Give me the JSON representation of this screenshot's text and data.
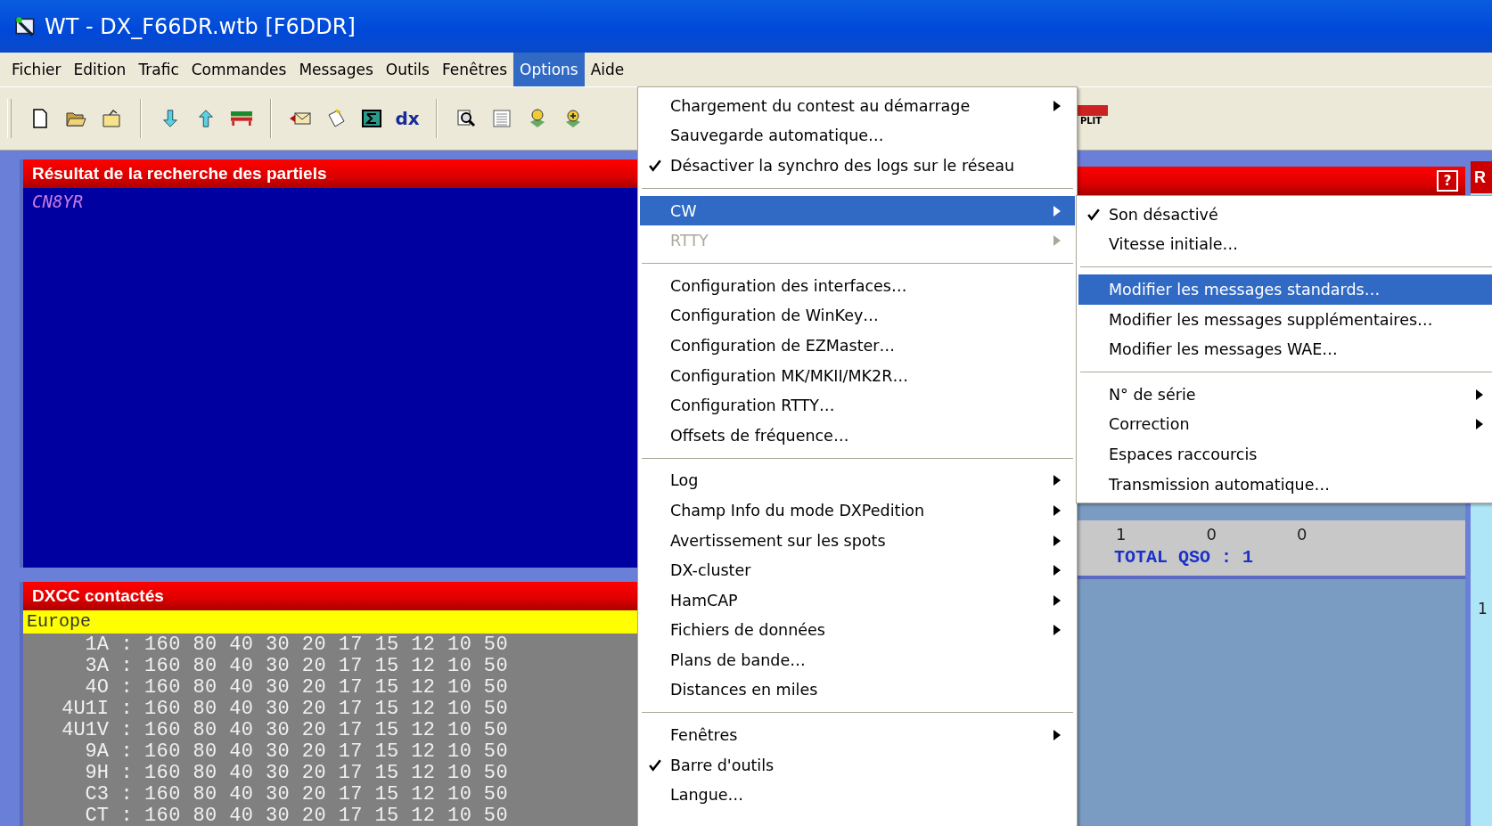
{
  "window": {
    "title": "WT - DX_F66DR.wtb [F6DDR]"
  },
  "menu_bar": [
    {
      "label": "Fichier",
      "selected": false
    },
    {
      "label": "Edition",
      "selected": false
    },
    {
      "label": "Trafic",
      "selected": false
    },
    {
      "label": "Commandes",
      "selected": false
    },
    {
      "label": "Messages",
      "selected": false
    },
    {
      "label": "Outils",
      "selected": false
    },
    {
      "label": "Fenêtres",
      "selected": false
    },
    {
      "label": "Options",
      "selected": true
    },
    {
      "label": "Aide",
      "selected": false
    }
  ],
  "toolbar": [
    {
      "kind": "new-file"
    },
    {
      "kind": "open-folder"
    },
    {
      "kind": "folder"
    },
    {
      "kind": "separator"
    },
    {
      "kind": "arrow-down"
    },
    {
      "kind": "arrow-up"
    },
    {
      "kind": "bars"
    },
    {
      "kind": "separator"
    },
    {
      "kind": "envelope"
    },
    {
      "kind": "note"
    },
    {
      "kind": "sigma"
    },
    {
      "kind": "text",
      "label": "dx"
    },
    {
      "kind": "separator"
    },
    {
      "kind": "magnifier"
    },
    {
      "kind": "grid"
    },
    {
      "kind": "pin"
    },
    {
      "kind": "pin2"
    }
  ],
  "split_button": {
    "label": "PLIT"
  },
  "search_panel": {
    "title": "Résultat de la recherche des partiels",
    "entries": [
      "CN8YR"
    ]
  },
  "dxcc_panel": {
    "title": "DXCC contactés",
    "region": "Europe",
    "rows": [
      {
        "prefix": "1A",
        "sep": ":",
        "bands": "160 80 40 30 20 17 15 12 10 50"
      },
      {
        "prefix": "3A",
        "sep": ":",
        "bands": "160 80 40 30 20 17 15 12 10 50"
      },
      {
        "prefix": "4O",
        "sep": ":",
        "bands": "160 80 40 30 20 17 15 12 10 50"
      },
      {
        "prefix": "4U1I",
        "sep": ":",
        "bands": "160 80 40 30 20 17 15 12 10 50"
      },
      {
        "prefix": "4U1V",
        "sep": ":",
        "bands": "160 80 40 30 20 17 15 12 10 50"
      },
      {
        "prefix": "9A",
        "sep": ":",
        "bands": "160 80 40 30 20 17 15 12 10 50"
      },
      {
        "prefix": "9H",
        "sep": ":",
        "bands": "160 80 40 30 20 17 15 12 10 50"
      },
      {
        "prefix": "C3",
        "sep": ":",
        "bands": "160 80 40 30 20 17 15 12 10 50"
      },
      {
        "prefix": "CT",
        "sep": ":",
        "bands": "160 80 40 30 20 17 15 12 10 50"
      }
    ]
  },
  "stats_panel": {
    "help_label": "?",
    "counts": [
      "1",
      "0",
      "0"
    ],
    "total": "TOTAL QSO : 1"
  },
  "side_panel": {
    "header": "R",
    "value": "1"
  },
  "options_menu": [
    {
      "kind": "item",
      "label": "Chargement du contest au démarrage",
      "checked": false,
      "disabled": false,
      "submenu": true,
      "selected": false
    },
    {
      "kind": "item",
      "label": "Sauvegarde automatique…",
      "checked": false,
      "disabled": false,
      "submenu": false,
      "selected": false
    },
    {
      "kind": "item",
      "label": "Désactiver la synchro des logs sur le réseau",
      "checked": true,
      "disabled": false,
      "submenu": false,
      "selected": false
    },
    {
      "kind": "separator"
    },
    {
      "kind": "item",
      "label": "CW",
      "checked": false,
      "disabled": false,
      "submenu": true,
      "selected": true
    },
    {
      "kind": "item",
      "label": "RTTY",
      "checked": false,
      "disabled": true,
      "submenu": true,
      "selected": false
    },
    {
      "kind": "separator"
    },
    {
      "kind": "item",
      "label": "Configuration des interfaces…",
      "checked": false,
      "disabled": false,
      "submenu": false,
      "selected": false
    },
    {
      "kind": "item",
      "label": "Configuration de WinKey…",
      "checked": false,
      "disabled": false,
      "submenu": false,
      "selected": false
    },
    {
      "kind": "item",
      "label": "Configuration de EZMaster…",
      "checked": false,
      "disabled": false,
      "submenu": false,
      "selected": false
    },
    {
      "kind": "item",
      "label": "Configuration MK/MKII/MK2R…",
      "checked": false,
      "disabled": false,
      "submenu": false,
      "selected": false
    },
    {
      "kind": "item",
      "label": "Configuration RTTY…",
      "checked": false,
      "disabled": false,
      "submenu": false,
      "selected": false
    },
    {
      "kind": "item",
      "label": "Offsets de fréquence…",
      "checked": false,
      "disabled": false,
      "submenu": false,
      "selected": false
    },
    {
      "kind": "separator"
    },
    {
      "kind": "item",
      "label": "Log",
      "checked": false,
      "disabled": false,
      "submenu": true,
      "selected": false
    },
    {
      "kind": "item",
      "label": "Champ Info du mode DXPedition",
      "checked": false,
      "disabled": false,
      "submenu": true,
      "selected": false
    },
    {
      "kind": "item",
      "label": "Avertissement sur les spots",
      "checked": false,
      "disabled": false,
      "submenu": true,
      "selected": false
    },
    {
      "kind": "item",
      "label": "DX-cluster",
      "checked": false,
      "disabled": false,
      "submenu": true,
      "selected": false
    },
    {
      "kind": "item",
      "label": "HamCAP",
      "checked": false,
      "disabled": false,
      "submenu": true,
      "selected": false
    },
    {
      "kind": "item",
      "label": "Fichiers de données",
      "checked": false,
      "disabled": false,
      "submenu": true,
      "selected": false
    },
    {
      "kind": "item",
      "label": "Plans de bande…",
      "checked": false,
      "disabled": false,
      "submenu": false,
      "selected": false
    },
    {
      "kind": "item",
      "label": "Distances en miles",
      "checked": false,
      "disabled": false,
      "submenu": false,
      "selected": false
    },
    {
      "kind": "separator"
    },
    {
      "kind": "item",
      "label": "Fenêtres",
      "checked": false,
      "disabled": false,
      "submenu": true,
      "selected": false
    },
    {
      "kind": "item",
      "label": "Barre d'outils",
      "checked": true,
      "disabled": false,
      "submenu": false,
      "selected": false
    },
    {
      "kind": "item",
      "label": "Langue…",
      "checked": false,
      "disabled": false,
      "submenu": false,
      "selected": false
    }
  ],
  "cw_submenu": [
    {
      "kind": "item",
      "label": "Son désactivé",
      "checked": true,
      "disabled": false,
      "submenu": false,
      "selected": false
    },
    {
      "kind": "item",
      "label": "Vitesse initiale…",
      "checked": false,
      "disabled": false,
      "submenu": false,
      "selected": false
    },
    {
      "kind": "separator"
    },
    {
      "kind": "item",
      "label": "Modifier les messages standards…",
      "checked": false,
      "disabled": false,
      "submenu": false,
      "selected": true
    },
    {
      "kind": "item",
      "label": "Modifier les messages supplémentaires…",
      "checked": false,
      "disabled": false,
      "submenu": false,
      "selected": false
    },
    {
      "kind": "item",
      "label": "Modifier les messages WAE…",
      "checked": false,
      "disabled": false,
      "submenu": false,
      "selected": false
    },
    {
      "kind": "separator"
    },
    {
      "kind": "item",
      "label": "N° de série",
      "checked": false,
      "disabled": false,
      "submenu": true,
      "selected": false
    },
    {
      "kind": "item",
      "label": "Correction",
      "checked": false,
      "disabled": false,
      "submenu": true,
      "selected": false
    },
    {
      "kind": "item",
      "label": "Espaces raccourcis",
      "checked": false,
      "disabled": false,
      "submenu": false,
      "selected": false
    },
    {
      "kind": "item",
      "label": "Transmission automatique…",
      "checked": false,
      "disabled": false,
      "submenu": false,
      "selected": false
    }
  ]
}
